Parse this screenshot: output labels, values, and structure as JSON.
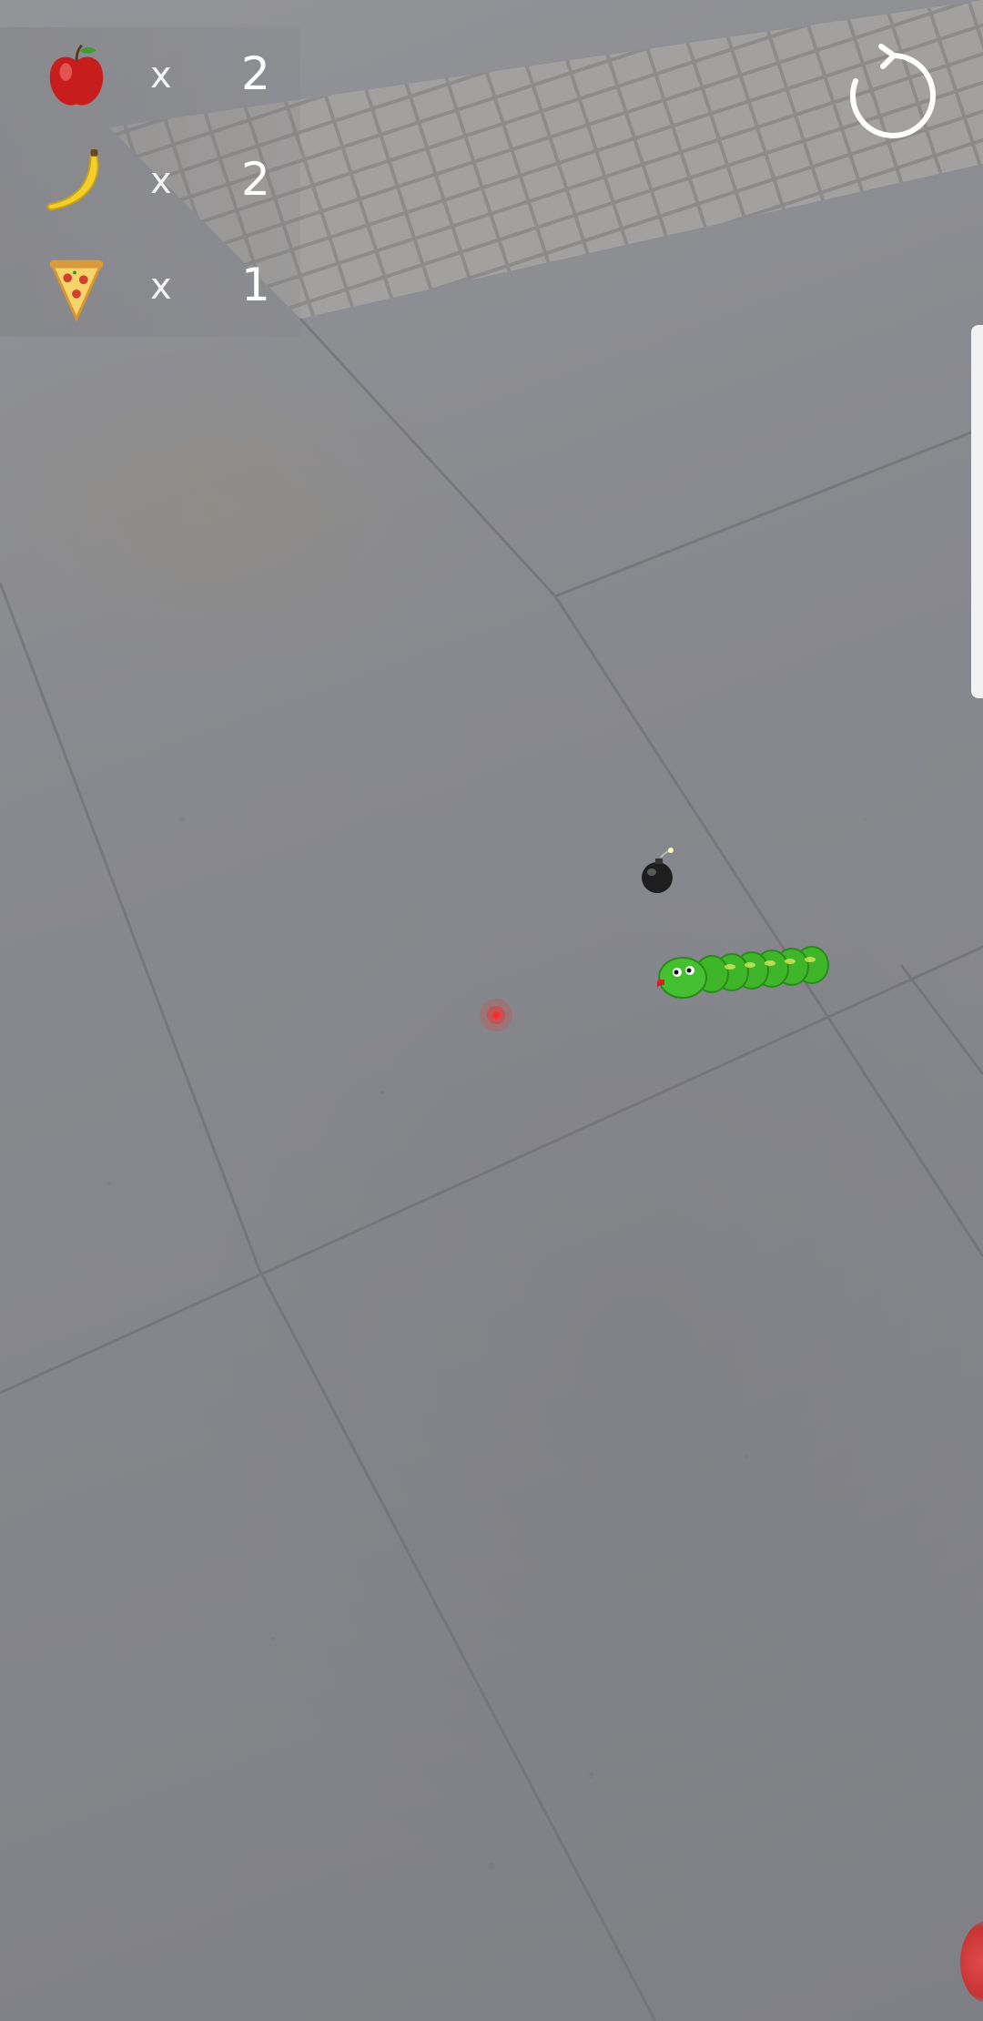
{
  "hud": {
    "items": [
      {
        "icon": "apple-icon",
        "times": "x",
        "count": "2"
      },
      {
        "icon": "banana-icon",
        "times": "x",
        "count": "2"
      },
      {
        "icon": "pizza-icon",
        "times": "x",
        "count": "1"
      }
    ]
  },
  "restart": {
    "icon": "restart-icon"
  },
  "scene": {
    "objects": [
      "bomb-icon",
      "snake",
      "target-marker"
    ]
  }
}
